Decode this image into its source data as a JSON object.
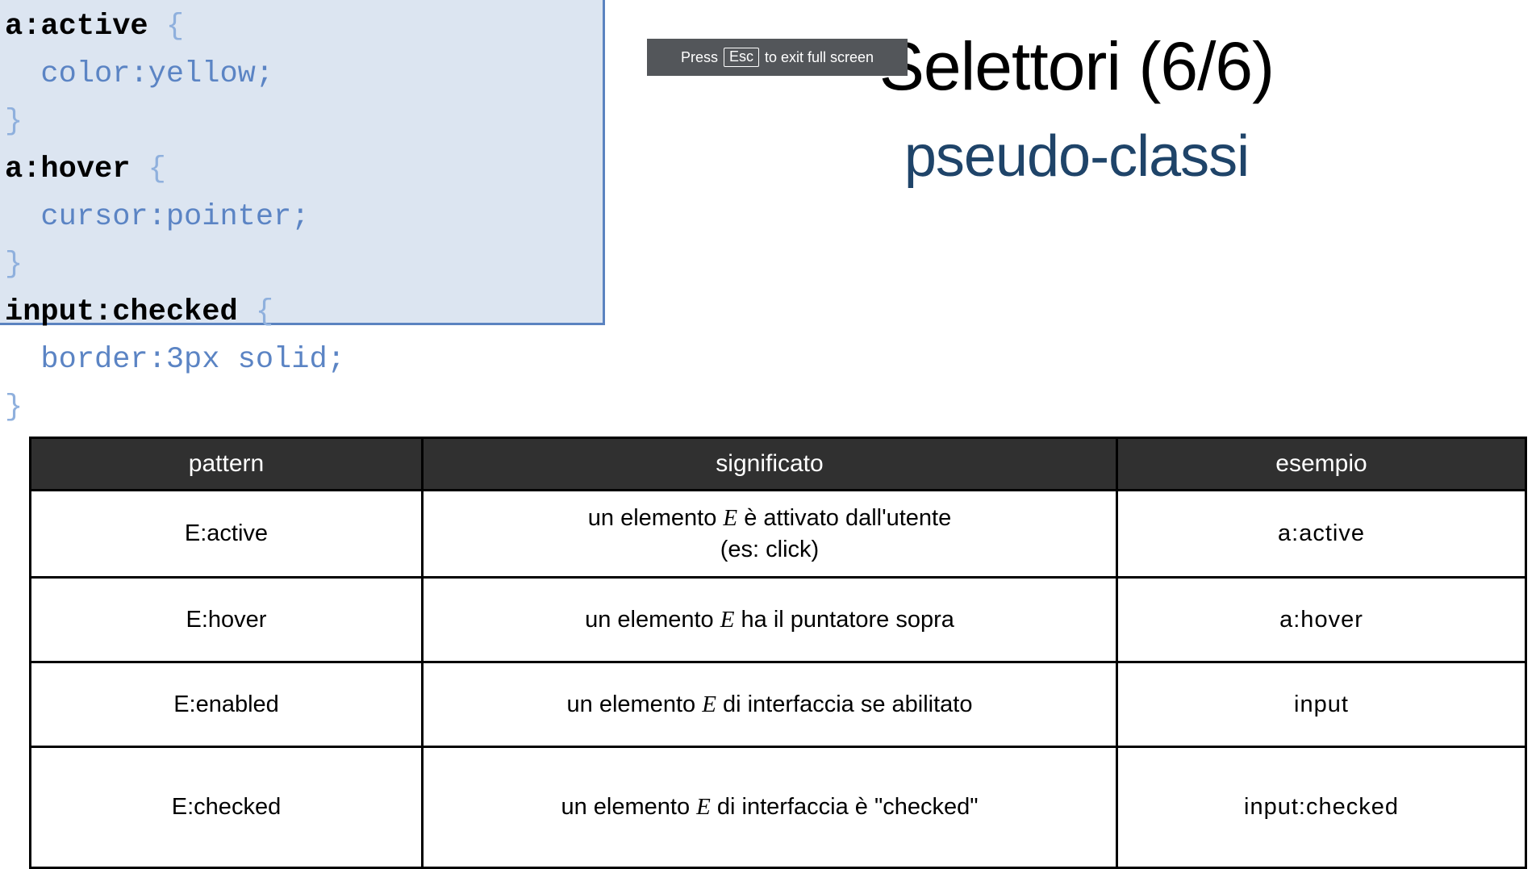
{
  "slide": {
    "title": "Selettori (6/6)",
    "subtitle": "pseudo-classi"
  },
  "fullscreen_hint": {
    "prefix": "Press",
    "key": "Esc",
    "suffix": "to exit full screen"
  },
  "code_sample": {
    "lines": [
      {
        "selector": "a:active",
        "brace_open": "{"
      },
      {
        "property": "color:yellow;"
      },
      {
        "brace_close": "}"
      },
      {
        "selector": "a:hover",
        "brace_open": "{"
      },
      {
        "property": "cursor:pointer;"
      },
      {
        "brace_close": "}"
      },
      {
        "selector": "input:checked",
        "brace_open": "{"
      },
      {
        "property": "border:3px solid;"
      },
      {
        "brace_close": "}"
      }
    ],
    "l1_selector": "a:active",
    "l1_brace": "{",
    "l2_property": "color:yellow;",
    "l3_brace": "}",
    "l4_selector": "a:hover",
    "l4_brace": "{",
    "l5_property": "cursor:pointer;",
    "l6_brace": "}",
    "l7_selector": "input:checked",
    "l7_brace": "{",
    "l8_property": "border:3px solid;",
    "l9_brace": "}",
    "highlight_color": "#dce5f1",
    "highlight_border_color": "#5b83c0",
    "property_color": "#5b84c4"
  },
  "table": {
    "headers": [
      "pattern",
      "significato",
      "esempio"
    ],
    "rows": [
      {
        "pattern": "E:active",
        "significato_pre": "un elemento ",
        "significato_em": "E",
        "significato_post": " è attivato dall'utente",
        "significato_line2": "(es: click)",
        "esempio": "a:active"
      },
      {
        "pattern": "E:hover",
        "significato_pre": "un elemento ",
        "significato_em": "E",
        "significato_post": " ha il puntatore sopra",
        "significato_line2": "",
        "esempio": "a:hover"
      },
      {
        "pattern": "E:enabled",
        "significato_pre": "un elemento ",
        "significato_em": "E",
        "significato_post": " di interfaccia se abilitato",
        "significato_line2": "",
        "esempio": "input"
      },
      {
        "pattern": "E:checked",
        "significato_pre": "un elemento ",
        "significato_em": "E",
        "significato_post": " di interfaccia è \"checked\"",
        "significato_line2": "",
        "esempio": "input:checked"
      }
    ],
    "header_bg": "#303030",
    "border_color": "#000000"
  }
}
